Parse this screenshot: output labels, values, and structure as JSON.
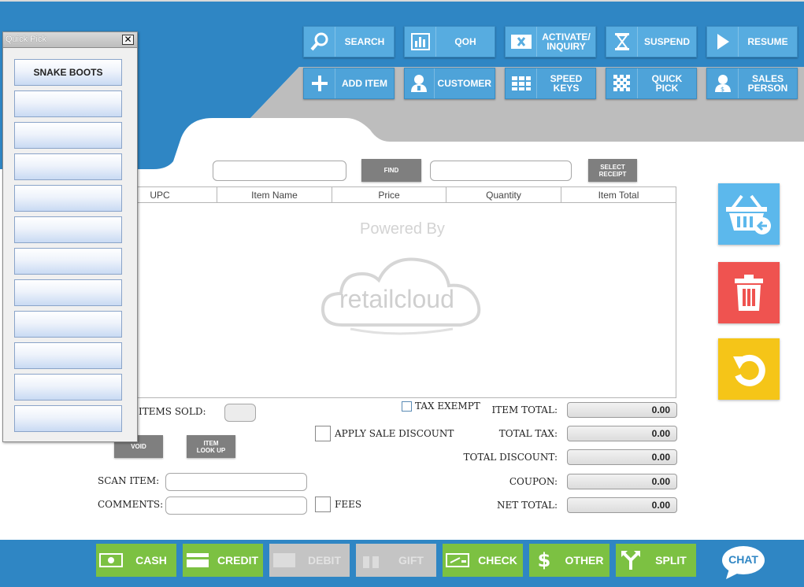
{
  "toolbar": {
    "row1": [
      {
        "label": "SEARCH",
        "icon": "search-icon"
      },
      {
        "label": "QOH",
        "icon": "bar-chart-icon"
      },
      {
        "label": "ACTIVATE/\nINQUIRY",
        "icon": "card-icon"
      },
      {
        "label": "SUSPEND",
        "icon": "hourglass-icon"
      },
      {
        "label": "RESUME",
        "icon": "play-icon"
      }
    ],
    "row2": [
      {
        "label": "ADD ITEM",
        "icon": "plus-icon"
      },
      {
        "label": "CUSTOMER",
        "icon": "customer-icon"
      },
      {
        "label": "SPEED KEYS",
        "icon": "keypad-icon"
      },
      {
        "label": "QUICK PICK",
        "icon": "grid-dots-icon"
      },
      {
        "label": "SALES\nPERSON",
        "icon": "salesperson-icon"
      }
    ]
  },
  "find": {
    "find_label": "FIND",
    "select_receipt_label": "SELECT\nRECEIPT"
  },
  "grid": {
    "columns": [
      "UPC",
      "Item Name",
      "Price",
      "Quantity",
      "Item Total"
    ],
    "watermark_top": "Powered By",
    "watermark_brand": "retailcloud"
  },
  "summary": {
    "items_sold_label": "ITEMS SOLD:",
    "tax_exempt_label": "TAX EXEMPT",
    "apply_sale_discount_label": "APPLY SALE DISCOUNT",
    "void_label": "VOID",
    "item_lookup_label": "ITEM\nLOOK UP",
    "scan_item_label": "SCAN ITEM:",
    "comments_label": "COMMENTS:",
    "fees_label": "FEES",
    "totals": [
      {
        "label": "ITEM TOTAL:",
        "value": "0.00"
      },
      {
        "label": "TOTAL TAX:",
        "value": "0.00"
      },
      {
        "label": "TOTAL DISCOUNT:",
        "value": "0.00"
      },
      {
        "label": "COUPON:",
        "value": "0.00"
      },
      {
        "label": "NET TOTAL:",
        "value": "0.00"
      }
    ]
  },
  "payments": [
    {
      "label": "CASH",
      "enabled": true
    },
    {
      "label": "CREDIT",
      "enabled": true
    },
    {
      "label": "DEBIT",
      "enabled": false
    },
    {
      "label": "GIFT",
      "enabled": false
    },
    {
      "label": "CHECK",
      "enabled": true
    },
    {
      "label": "OTHER",
      "enabled": true
    },
    {
      "label": "SPLIT",
      "enabled": true
    }
  ],
  "chat_label": "CHAT",
  "quick_pick": {
    "title": "Quick Pick",
    "close_glyph": "✕",
    "buttons": [
      "SNAKE BOOTS",
      "",
      "",
      "",
      "",
      "",
      "",
      "",
      "",
      "",
      "",
      ""
    ]
  },
  "colors": {
    "accent_blue": "#2f86c4",
    "button_blue": "#4ea3d9",
    "pay_green": "#7cc142",
    "delete_red": "#ef5350",
    "undo_yellow": "#f5c518",
    "basket_blue": "#5cb8ec"
  }
}
